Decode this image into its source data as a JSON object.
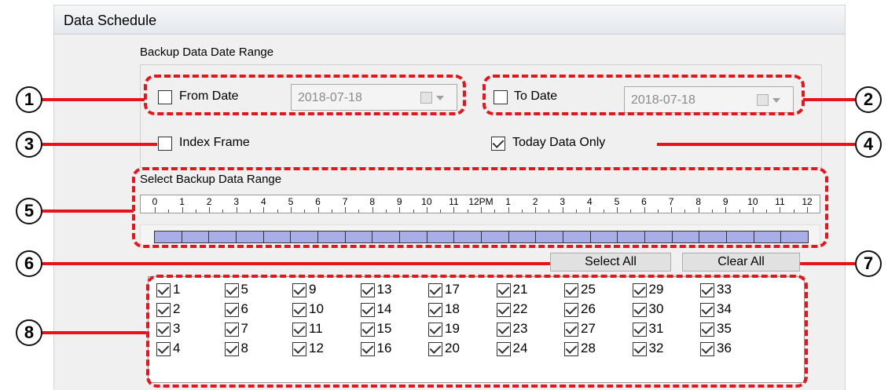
{
  "panel": {
    "title": "Data Schedule"
  },
  "date_range": {
    "group_label": "Backup Data Date Range",
    "from": {
      "label": "From Date",
      "checked": false,
      "value": "2018-07-18"
    },
    "to": {
      "label": "To Date",
      "checked": false,
      "value": "2018-07-18"
    }
  },
  "options": {
    "index_frame": {
      "label": "Index Frame",
      "checked": false
    },
    "today_only": {
      "label": "Today Data Only",
      "checked": true
    }
  },
  "time_range": {
    "label": "Select Backup Data Range",
    "ticks": [
      "0",
      "1",
      "2",
      "3",
      "4",
      "5",
      "6",
      "7",
      "8",
      "9",
      "10",
      "11",
      "12PM",
      "1",
      "2",
      "3",
      "4",
      "5",
      "6",
      "7",
      "8",
      "9",
      "10",
      "11",
      "12"
    ],
    "selected_slots": 24
  },
  "buttons": {
    "select_all": "Select All",
    "clear_all": "Clear All"
  },
  "channels": [
    {
      "label": "1",
      "checked": true
    },
    {
      "label": "2",
      "checked": true
    },
    {
      "label": "3",
      "checked": true
    },
    {
      "label": "4",
      "checked": true
    },
    {
      "label": "5",
      "checked": true
    },
    {
      "label": "6",
      "checked": true
    },
    {
      "label": "7",
      "checked": true
    },
    {
      "label": "8",
      "checked": true
    },
    {
      "label": "9",
      "checked": true
    },
    {
      "label": "10",
      "checked": true
    },
    {
      "label": "11",
      "checked": true
    },
    {
      "label": "12",
      "checked": true
    },
    {
      "label": "13",
      "checked": true
    },
    {
      "label": "14",
      "checked": true
    },
    {
      "label": "15",
      "checked": true
    },
    {
      "label": "16",
      "checked": true
    },
    {
      "label": "17",
      "checked": true
    },
    {
      "label": "18",
      "checked": true
    },
    {
      "label": "19",
      "checked": true
    },
    {
      "label": "20",
      "checked": true
    },
    {
      "label": "21",
      "checked": true
    },
    {
      "label": "22",
      "checked": true
    },
    {
      "label": "23",
      "checked": true
    },
    {
      "label": "24",
      "checked": true
    },
    {
      "label": "25",
      "checked": true
    },
    {
      "label": "26",
      "checked": true
    },
    {
      "label": "27",
      "checked": true
    },
    {
      "label": "28",
      "checked": true
    },
    {
      "label": "29",
      "checked": true
    },
    {
      "label": "30",
      "checked": true
    },
    {
      "label": "31",
      "checked": true
    },
    {
      "label": "32",
      "checked": true
    },
    {
      "label": "33",
      "checked": true
    },
    {
      "label": "34",
      "checked": true
    },
    {
      "label": "35",
      "checked": true
    },
    {
      "label": "36",
      "checked": true
    }
  ],
  "callouts": [
    "1",
    "2",
    "3",
    "4",
    "5",
    "6",
    "7",
    "8"
  ],
  "colors": {
    "annotation_red": "#e8141b",
    "slot_fill": "#a9aee6"
  }
}
